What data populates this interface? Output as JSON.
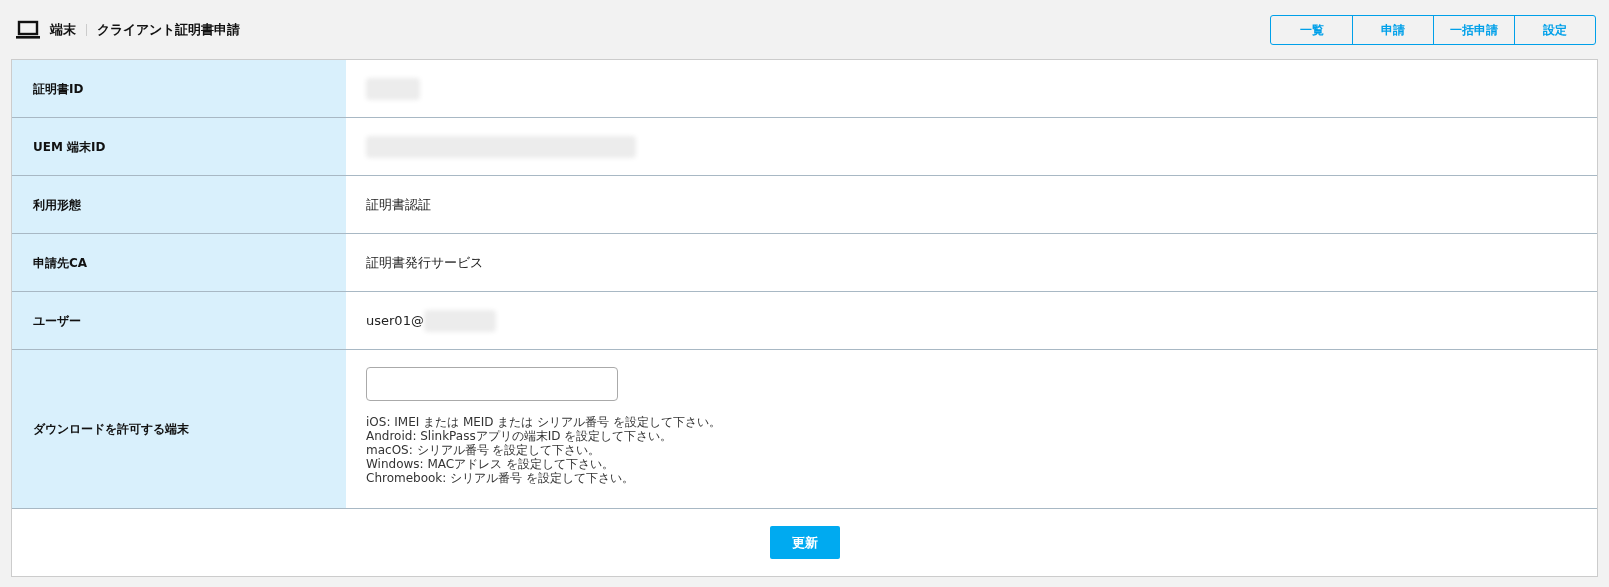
{
  "header": {
    "section": "端末",
    "title": "クライアント証明書申請"
  },
  "nav_buttons": [
    {
      "label": "一覧"
    },
    {
      "label": "申請"
    },
    {
      "label": "一括申請"
    },
    {
      "label": "設定"
    }
  ],
  "rows": [
    {
      "label": "証明書ID",
      "kind": "redacted",
      "redacted": true
    },
    {
      "label": "UEM 端末ID",
      "kind": "redacted",
      "redacted": true
    },
    {
      "label": "利用形態",
      "kind": "text",
      "value": "証明書認証"
    },
    {
      "label": "申請先CA",
      "kind": "text",
      "value": "証明書発行サービス"
    },
    {
      "label": "ユーザー",
      "kind": "text",
      "value": "user01@",
      "redacted": true
    },
    {
      "label": "ダウンロードを許可する端末",
      "kind": "input",
      "help": [
        "iOS: IMEI または MEID または シリアル番号 を設定して下さい。",
        "Android: SlinkPassアプリの端末ID を設定して下さい。",
        "macOS: シリアル番号 を設定して下さい。",
        "Windows: MACアドレス を設定して下さい。",
        "Chromebook: シリアル番号 を設定して下さい。"
      ]
    }
  ],
  "submit": "更新"
}
